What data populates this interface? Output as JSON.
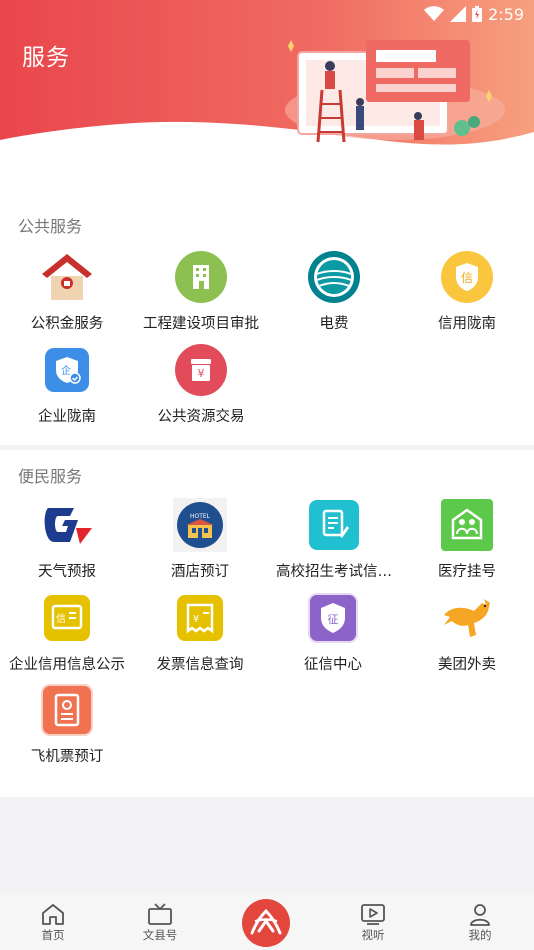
{
  "status_bar": {
    "time": "2:59"
  },
  "header": {
    "title": "服务"
  },
  "public_services": {
    "title": "公共服务",
    "items": [
      {
        "label": "公积金服务",
        "icon": "house-icon"
      },
      {
        "label": "工程建设项目审批",
        "icon": "building-icon"
      },
      {
        "label": "电费",
        "icon": "state-grid-logo-icon"
      },
      {
        "label": "信用陇南",
        "icon": "credit-badge-icon"
      },
      {
        "label": "企业陇南",
        "icon": "enterprise-shield-icon"
      },
      {
        "label": "公共资源交易",
        "icon": "yuan-box-icon"
      }
    ]
  },
  "convenience_services": {
    "title": "便民服务",
    "items": [
      {
        "label": "天气预报",
        "icon": "weather-logo-icon"
      },
      {
        "label": "酒店预订",
        "icon": "hotel-icon"
      },
      {
        "label": "高校招生考试信…",
        "icon": "exam-document-icon"
      },
      {
        "label": "医疗挂号",
        "icon": "medical-icon"
      },
      {
        "label": "企业信用信息公示",
        "icon": "credit-info-icon"
      },
      {
        "label": "发票信息查询",
        "icon": "invoice-icon"
      },
      {
        "label": "征信中心",
        "icon": "credit-center-icon"
      },
      {
        "label": "美团外卖",
        "icon": "meituan-kangaroo-icon"
      },
      {
        "label": "飞机票预订",
        "icon": "flight-ticket-icon"
      }
    ]
  },
  "hotel_sign_text": "HOTEL",
  "badge_chars": {
    "credit": "信",
    "enterprise": "企",
    "yuan": "¥",
    "credit_info": "信",
    "invoice": "¥",
    "credit_center": "征"
  },
  "tabbar": {
    "items": [
      {
        "label": "首页",
        "icon": "home-icon"
      },
      {
        "label": "文县号",
        "icon": "tv-icon"
      },
      {
        "label": "",
        "icon": "center-logo-icon"
      },
      {
        "label": "视听",
        "icon": "play-icon"
      },
      {
        "label": "我的",
        "icon": "user-icon"
      }
    ]
  },
  "colors": {
    "header_start": "#e9464c",
    "header_end": "#f7a07e",
    "accent_red": "#e2463d"
  }
}
